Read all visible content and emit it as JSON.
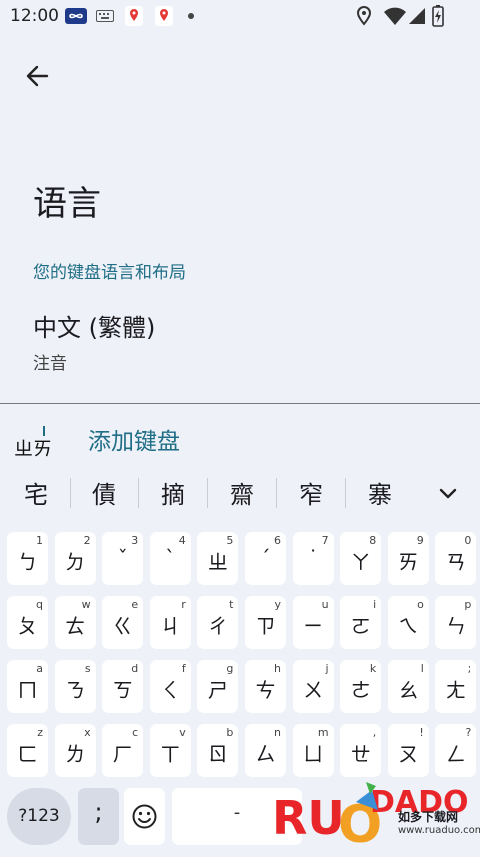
{
  "status_bar": {
    "time": "12:00",
    "icons": [
      "infinity-app-icon",
      "keyboard-icon",
      "maps-pin-icon",
      "maps-pin-icon",
      "dot-icon",
      "location-icon",
      "wifi-icon",
      "battery-icon"
    ]
  },
  "page": {
    "title": "语言",
    "section_header": "您的键盘语言和布局",
    "language_name": "中文 (繁體)",
    "language_layout": "注音",
    "add_keyboard": "添加键盘"
  },
  "ime": {
    "composing_text": "ㄓㄞ",
    "candidates": [
      "宅",
      "債",
      "摘",
      "齋",
      "窄",
      "寨"
    ],
    "rows": [
      [
        {
          "k": "ㄅ",
          "h": "1"
        },
        {
          "k": "ㄉ",
          "h": "2"
        },
        {
          "k": "ˇ",
          "h": "3"
        },
        {
          "k": "ˋ",
          "h": "4"
        },
        {
          "k": "ㄓ",
          "h": "5"
        },
        {
          "k": "ˊ",
          "h": "6"
        },
        {
          "k": "˙",
          "h": "7"
        },
        {
          "k": "ㄚ",
          "h": "8"
        },
        {
          "k": "ㄞ",
          "h": "9"
        },
        {
          "k": "ㄢ",
          "h": "0"
        }
      ],
      [
        {
          "k": "ㄆ",
          "h": "q"
        },
        {
          "k": "ㄊ",
          "h": "w"
        },
        {
          "k": "ㄍ",
          "h": "e"
        },
        {
          "k": "ㄐ",
          "h": "r"
        },
        {
          "k": "ㄔ",
          "h": "t"
        },
        {
          "k": "ㄗ",
          "h": "y"
        },
        {
          "k": "ㄧ",
          "h": "u"
        },
        {
          "k": "ㄛ",
          "h": "i"
        },
        {
          "k": "ㄟ",
          "h": "o"
        },
        {
          "k": "ㄣ",
          "h": "p"
        }
      ],
      [
        {
          "k": "ㄇ",
          "h": "a"
        },
        {
          "k": "ㄋ",
          "h": "s"
        },
        {
          "k": "ㄎ",
          "h": "d"
        },
        {
          "k": "ㄑ",
          "h": "f"
        },
        {
          "k": "ㄕ",
          "h": "g"
        },
        {
          "k": "ㄘ",
          "h": "h"
        },
        {
          "k": "ㄨ",
          "h": "j"
        },
        {
          "k": "ㄜ",
          "h": "k"
        },
        {
          "k": "ㄠ",
          "h": "l"
        },
        {
          "k": "ㄤ",
          "h": ";"
        }
      ],
      [
        {
          "k": "ㄈ",
          "h": "z"
        },
        {
          "k": "ㄌ",
          "h": "x"
        },
        {
          "k": "ㄏ",
          "h": "c"
        },
        {
          "k": "ㄒ",
          "h": "v"
        },
        {
          "k": "ㄖ",
          "h": "b"
        },
        {
          "k": "ㄙ",
          "h": "n"
        },
        {
          "k": "ㄩ",
          "h": "m"
        },
        {
          "k": "ㄝ",
          "h": ","
        },
        {
          "k": "ㄡ",
          "h": "!"
        },
        {
          "k": "ㄥ",
          "h": "?"
        }
      ]
    ],
    "symbols_key": "?123",
    "semicolon_key": ";",
    "space_key": "-",
    "emoji_key": "emoji-icon"
  },
  "watermark": {
    "brand": "RUANDADO",
    "chinese": "如多下载网",
    "url": "www.ruaduo.com"
  },
  "colors": {
    "background": "#eef1f8",
    "accent": "#1f6e86",
    "key": "#ffffff",
    "function_key": "#c3d7ee",
    "watermark_red": "#e8262a",
    "watermark_orange": "#f2a023"
  }
}
